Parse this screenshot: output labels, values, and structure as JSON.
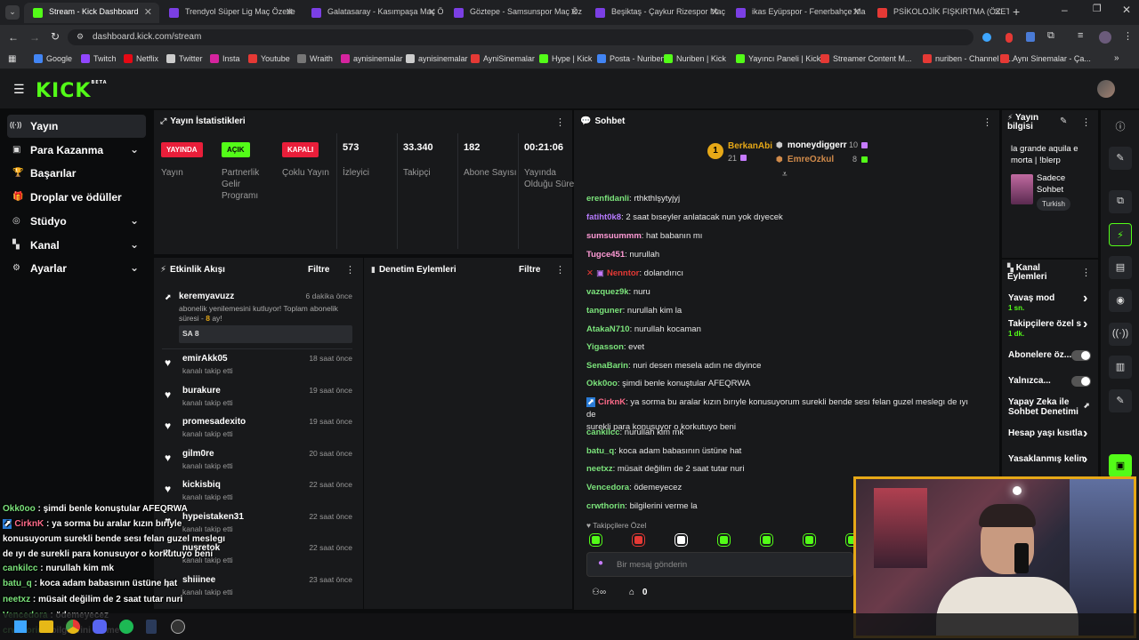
{
  "browser": {
    "tabs": [
      {
        "label": "Stream - Kick Dashboard",
        "color": "#53fc18"
      },
      {
        "label": "Trendyol Süper Lig Maç Özetle",
        "color": "#7b3fe4"
      },
      {
        "label": "Galatasaray - Kasımpaşa Maç Ö",
        "color": "#7b3fe4"
      },
      {
        "label": "Göztepe - Samsunspor Maç Öz",
        "color": "#7b3fe4"
      },
      {
        "label": "Beşiktaş - Çaykur Rizespor Maç",
        "color": "#7b3fe4"
      },
      {
        "label": "ikas Eyüpspor - Fenerbahçe Ma",
        "color": "#7b3fe4"
      },
      {
        "label": "PSİKOLOJİK FIŞKIRTMA (ÖZET_",
        "color": "#e53935"
      }
    ],
    "url": "dashboard.kick.com/stream",
    "bookmarks": [
      {
        "label": "Google",
        "color": "#4285f4"
      },
      {
        "label": "Twitch",
        "color": "#9146ff"
      },
      {
        "label": "Netflix",
        "color": "#e50914"
      },
      {
        "label": "Twitter",
        "color": "#cccccc"
      },
      {
        "label": "Insta",
        "color": "#d6249f"
      },
      {
        "label": "Youtube",
        "color": "#e53935"
      },
      {
        "label": "Wraith",
        "color": "#777777"
      },
      {
        "label": "aynisinemalar",
        "color": "#d6249f"
      },
      {
        "label": "aynisinemalar",
        "color": "#cccccc"
      },
      {
        "label": "AyniSinemalar",
        "color": "#e53935"
      },
      {
        "label": "Hype | Kick",
        "color": "#53fc18"
      },
      {
        "label": "Posta - Nuriben",
        "color": "#4285f4"
      },
      {
        "label": "Nuriben | Kick",
        "color": "#53fc18"
      },
      {
        "label": "Yayıncı Paneli | Kick",
        "color": "#53fc18"
      },
      {
        "label": "Streamer Content M...",
        "color": "#e53935"
      },
      {
        "label": "nuriben - Channel S...",
        "color": "#e53935"
      },
      {
        "label": "Aynı Sinemalar - Ça...",
        "color": "#e53935"
      }
    ]
  },
  "kick": {
    "logo": "KICK",
    "logo_sup": "BETA"
  },
  "sidebar": [
    {
      "label": "Yayın",
      "icon": "broadcast-icon",
      "selected": true,
      "chevron": false
    },
    {
      "label": "Para Kazanma",
      "icon": "money-icon",
      "chevron": true
    },
    {
      "label": "Başarılar",
      "icon": "trophy-icon",
      "chevron": false
    },
    {
      "label": "Droplar ve ödüller",
      "icon": "gift-icon",
      "chevron": false
    },
    {
      "label": "Stüdyo",
      "icon": "studio-icon",
      "chevron": true
    },
    {
      "label": "Kanal",
      "icon": "channel-icon",
      "chevron": true
    },
    {
      "label": "Ayarlar",
      "icon": "gear-icon",
      "chevron": true
    }
  ],
  "stats": {
    "title": "Yayın İstatistikleri",
    "items": [
      {
        "badge": "YAYINDA",
        "badge_color": "#e91e3a",
        "badge_text_color": "#ffffff",
        "label": "Yayın"
      },
      {
        "badge": "AÇIK",
        "badge_color": "#53fc18",
        "badge_text_color": "#0b0c0d",
        "label": "Partnerlik Gelir Programı"
      },
      {
        "badge": "KAPALI",
        "badge_color": "#e91e3a",
        "badge_text_color": "#ffffff",
        "label": "Çoklu Yayın"
      },
      {
        "value": "573",
        "label": "İzleyici"
      },
      {
        "value": "33.340",
        "label": "Takipçi"
      },
      {
        "value": "182",
        "label": "Abone Sayısı"
      },
      {
        "value": "00:21:06",
        "label": "Yayında Olduğu Süre"
      }
    ]
  },
  "activity": {
    "title": "Etkinlik Akışı",
    "filter": "Filtre",
    "sub": {
      "user": "keremyavuzz",
      "time": "6 dakika önce",
      "text1": "abonelik yenilemesini kutluyor! Toplam abonelik",
      "text2": "süresi - ",
      "months": "8",
      "text3": " ay!",
      "msg": "SA 8"
    },
    "follows": [
      {
        "user": "emirAkk05",
        "time": "18 saat önce"
      },
      {
        "user": "burakure",
        "time": "19 saat önce"
      },
      {
        "user": "promesadexito",
        "time": "19 saat önce"
      },
      {
        "user": "gilm0re",
        "time": "20 saat önce"
      },
      {
        "user": "kickisbiq",
        "time": "22 saat önce"
      },
      {
        "user": "hypeistaken31",
        "time": "22 saat önce"
      },
      {
        "user": "nusretok",
        "time": "22 saat önce"
      },
      {
        "user": "shiiinee",
        "time": "23 saat önce"
      }
    ],
    "follow_text": "kanalı takip etti"
  },
  "moderation": {
    "title": "Denetim Eylemleri",
    "filter": "Filtre"
  },
  "chat": {
    "title": "Sohbet",
    "leaders": {
      "first": {
        "rank": "1",
        "name": "BerkanAbi",
        "count": "21"
      },
      "second": {
        "name": "moneydiggerr",
        "count": "10"
      },
      "third": {
        "name": "EmreOzkul",
        "count": "8"
      }
    },
    "messages": [
      {
        "user": "erenfidanli",
        "color": "#7be37b",
        "text": "rthkthlşytyjyj"
      },
      {
        "user": "fatiht0k8",
        "color": "#b77bff",
        "text": "2 saat bıseyler anlatacak nun yok dıyecek"
      },
      {
        "user": "sumsuummm",
        "color": "#ff9ad5",
        "text": "hat babanın mı"
      },
      {
        "user": "Tugce451",
        "color": "#ff9ad5",
        "text": "nurullah"
      },
      {
        "user": "Nenntor",
        "color": "#e53935",
        "text": "dolandırıcı"
      },
      {
        "user": "vazquez9k",
        "color": "#7be37b",
        "text": "nuru"
      },
      {
        "user": "tanguner",
        "color": "#7be37b",
        "text": "nurullah kim la"
      },
      {
        "user": "AtakaN710",
        "color": "#7be37b",
        "text": "nurullah kocaman"
      },
      {
        "user": "Yigasson",
        "color": "#7be37b",
        "text": "evet"
      },
      {
        "user": "SenaBarin",
        "color": "#7be37b",
        "text": "nuri desen mesela adın ne diyince"
      },
      {
        "user": "Okk0oo",
        "color": "#7be37b",
        "text": "şimdi benle konuştular AFEQRWA"
      },
      {
        "user": "CirknK",
        "color": "#ff6b8a",
        "text": "ya sorma bu aralar kızın bırıyle konusuyorum surekli bende sesı felan guzel meslegı de ıyı de",
        "text2": "surekli para konusuyor o korkutuyo beni"
      },
      {
        "user": "cankilcc",
        "color": "#7be37b",
        "text": "nurullah kim mk"
      },
      {
        "user": "batu_q",
        "color": "#7be37b",
        "text": "koca adam babasının üstüne hat"
      },
      {
        "user": "neetxz",
        "color": "#7be37b",
        "text": "müsait değilim de 2 saat tutar nuri"
      },
      {
        "user": "Vencedora",
        "color": "#7be37b",
        "text": "ödemeyecez"
      },
      {
        "user": "crwthorin",
        "color": "#7be37b",
        "text": "bilgilerini verme la"
      }
    ],
    "followers_only": "Takipçilere Özel",
    "placeholder": "Bir mesaj gönderin",
    "points": "0"
  },
  "stream_info": {
    "title": "Yayın bilgisi",
    "stream_title": "la grande aquila e morta | !blerp",
    "category": "Sadece Sohbet",
    "tag": "Turkish"
  },
  "channel_actions": {
    "title": "Kanal Eylemleri",
    "items": [
      {
        "label": "Yavaş mod",
        "sub": "1 sn.",
        "control": "chevron"
      },
      {
        "label": "Takipçilere özel s",
        "sub": "1 dk.",
        "control": "chevron"
      },
      {
        "label": "Abonelere öz...",
        "control": "toggle"
      },
      {
        "label": "Yalnızca...",
        "control": "toggle"
      },
      {
        "label": "Yapay Zeka ile Sohbet Denetimi",
        "control": "external"
      },
      {
        "label": "Hesap yaşı kısıtla",
        "control": "chevron"
      },
      {
        "label": "Yasaklanmış kelin",
        "control": "chevron"
      }
    ]
  },
  "overlay_chat": [
    {
      "user": "Okk0oo",
      "color": "#7be37b",
      "text": "şimdi benle konuştular AFEQRWA"
    },
    {
      "user": "CirknK",
      "color": "#ff6b8a",
      "text": "ya sorma bu aralar kızın bırıyle"
    },
    {
      "user": "",
      "color": "#fff",
      "text": "konusuyorum surekli bende sesı felan guzel meslegı"
    },
    {
      "user": "",
      "color": "#fff",
      "text": "de ıyı de surekli para konusuyor o korkutuyo beni"
    },
    {
      "user": "cankilcc",
      "color": "#7be37b",
      "text": "nurullah kim mk"
    },
    {
      "user": "batu_q",
      "color": "#7be37b",
      "text": "koca adam babasının üstüne hat"
    },
    {
      "user": "neetxz",
      "color": "#7be37b",
      "text": "müsait değilim de 2 saat tutar nuri"
    },
    {
      "user": "Vencedora",
      "color": "#7be37b",
      "text": "ödemeyecez"
    },
    {
      "user": "crwthorin",
      "color": "#7be37b",
      "text": "bilgilerini verme la"
    }
  ]
}
